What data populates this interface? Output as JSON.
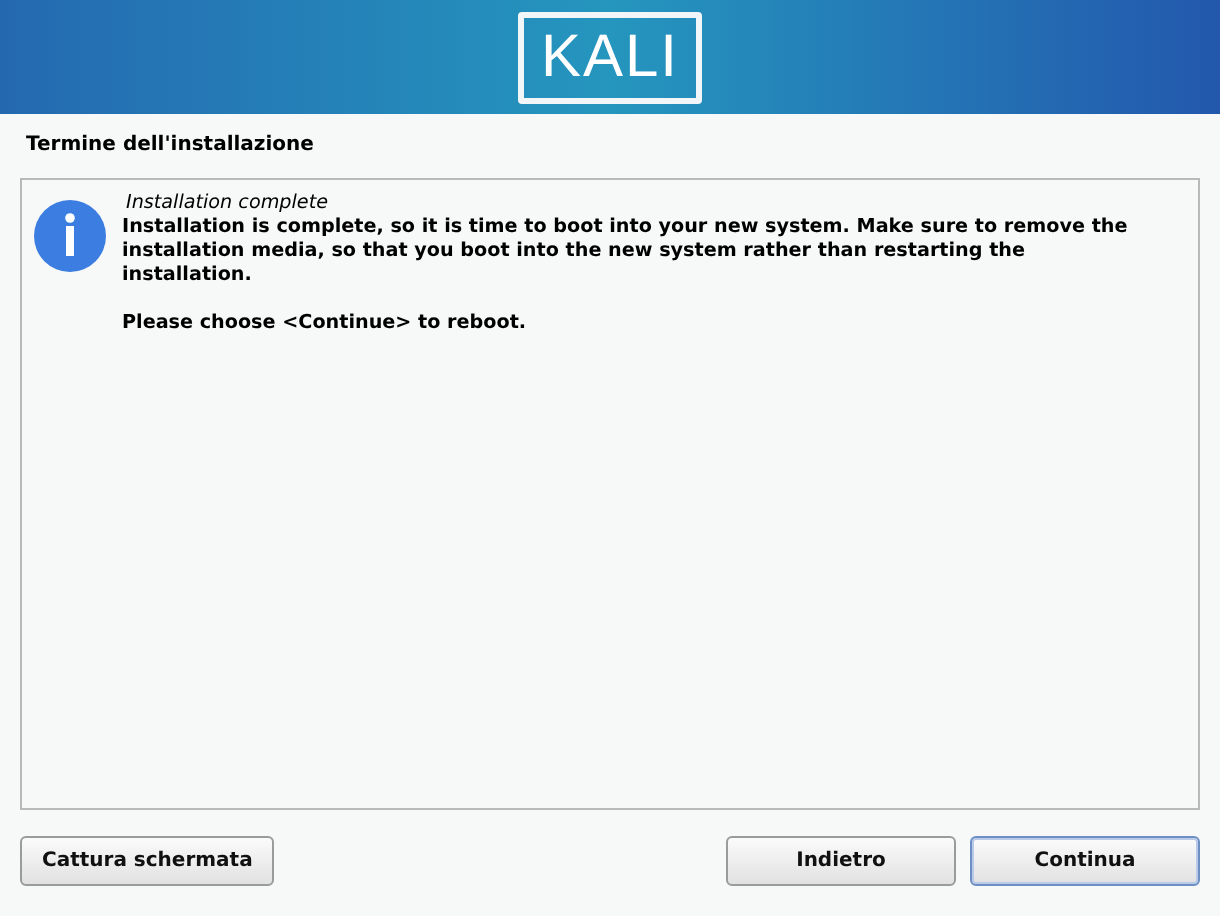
{
  "header": {
    "logo": "KALI"
  },
  "title": "Termine dell'installazione",
  "message": {
    "heading": "Installation complete",
    "body": "Installation is complete, so it is time to boot into your new system. Make sure to remove the installation media, so that you boot into the new system rather than restarting the installation.",
    "note": "Please choose <Continue> to reboot."
  },
  "buttons": [
    {
      "label": "Cattura schermata",
      "focused": false
    },
    {
      "label": "Indietro",
      "focused": false
    },
    {
      "label": "Continua",
      "focused": true
    }
  ]
}
